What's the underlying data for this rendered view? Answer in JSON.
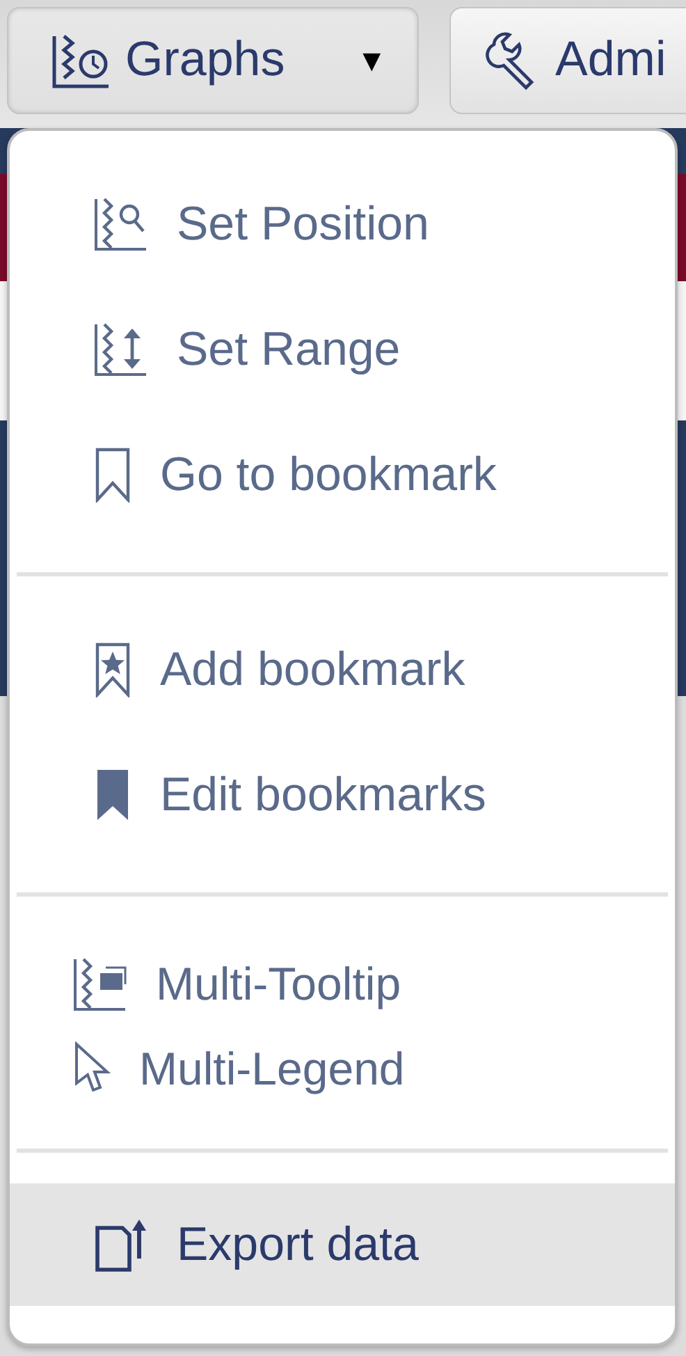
{
  "toolbar": [
    {
      "label": "Graphs",
      "caret": "▼",
      "expanded": true
    },
    {
      "label": "Admi",
      "expanded": false
    }
  ],
  "menu": {
    "groups": [
      {
        "kind": "large",
        "items": [
          {
            "label": "Set Position",
            "selected": false
          },
          {
            "label": "Set Range",
            "selected": false
          },
          {
            "label": "Go to bookmark",
            "selected": false
          }
        ]
      },
      {
        "kind": "large",
        "items": [
          {
            "label": "Add bookmark",
            "selected": false
          },
          {
            "label": "Edit bookmarks",
            "selected": false
          }
        ]
      },
      {
        "kind": "compact",
        "items": [
          {
            "label": "Multi-Tooltip",
            "selected": false
          },
          {
            "label": "Multi-Legend",
            "selected": false
          }
        ]
      },
      {
        "kind": "large",
        "items": [
          {
            "label": "Export data",
            "selected": true
          }
        ]
      }
    ]
  }
}
